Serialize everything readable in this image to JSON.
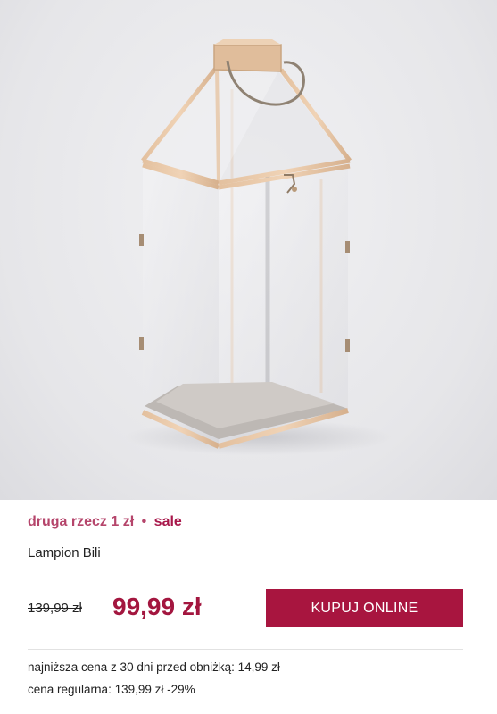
{
  "product": {
    "promo_text": "druga rzecz 1 zł",
    "promo_separator": "•",
    "promo_sale": "sale",
    "name": "Lampion Bili",
    "old_price": "139,99 zł",
    "new_price": "99,99 zł",
    "buy_label": "KUPUJ ONLINE",
    "lowest_price_note": "najniższa cena z 30 dni przed obniżką: 14,99 zł",
    "regular_price_note": "cena regularna: 139,99 zł -29%"
  },
  "colors": {
    "accent": "#a8153f",
    "promo": "#b5456b"
  },
  "icons": {
    "product_image": "glass-lantern"
  }
}
